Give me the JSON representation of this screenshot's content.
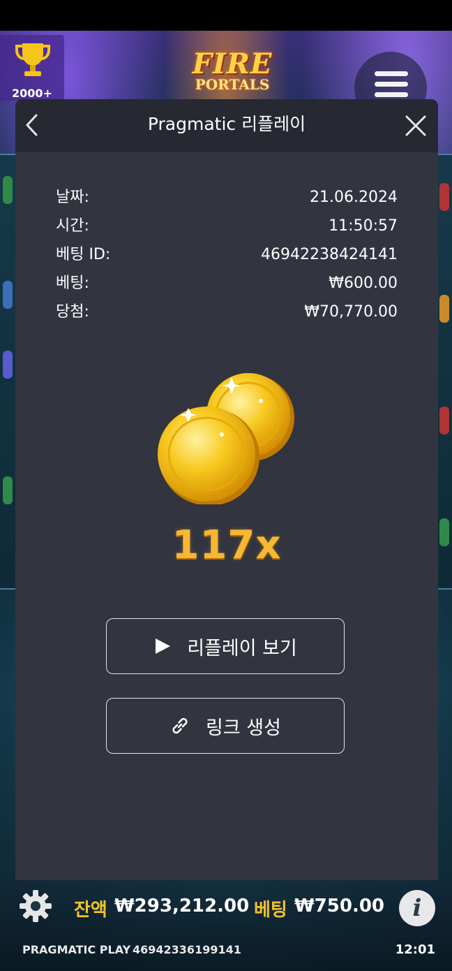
{
  "game": {
    "trophy_count": "2000+",
    "logo_line1": "FIRE",
    "logo_line2": "PORTALS"
  },
  "modal": {
    "title": "Pragmatic 리플레이",
    "rows": [
      {
        "label": "날짜:",
        "value": "21.06.2024"
      },
      {
        "label": "시간:",
        "value": "11:50:57"
      },
      {
        "label": "베팅 ID:",
        "value": "46942238424141"
      },
      {
        "label": "베팅:",
        "value": "₩600.00"
      },
      {
        "label": "당첨:",
        "value": "₩70,770.00"
      }
    ],
    "multiplier": "117x",
    "watch_button": "리플레이 보기",
    "link_button": "링크 생성"
  },
  "footer": {
    "balance_label": "잔액",
    "balance_value": "₩293,212.00",
    "bet_label": "베팅",
    "bet_value": "₩750.00",
    "info_glyph": "i",
    "brand": "PRAGMATIC PLAY",
    "round_id": "46942336199141",
    "time": "12:01"
  },
  "colors": {
    "modal_bg": "#32343f",
    "header_bg": "#262832",
    "gold": "#f4c22b"
  }
}
